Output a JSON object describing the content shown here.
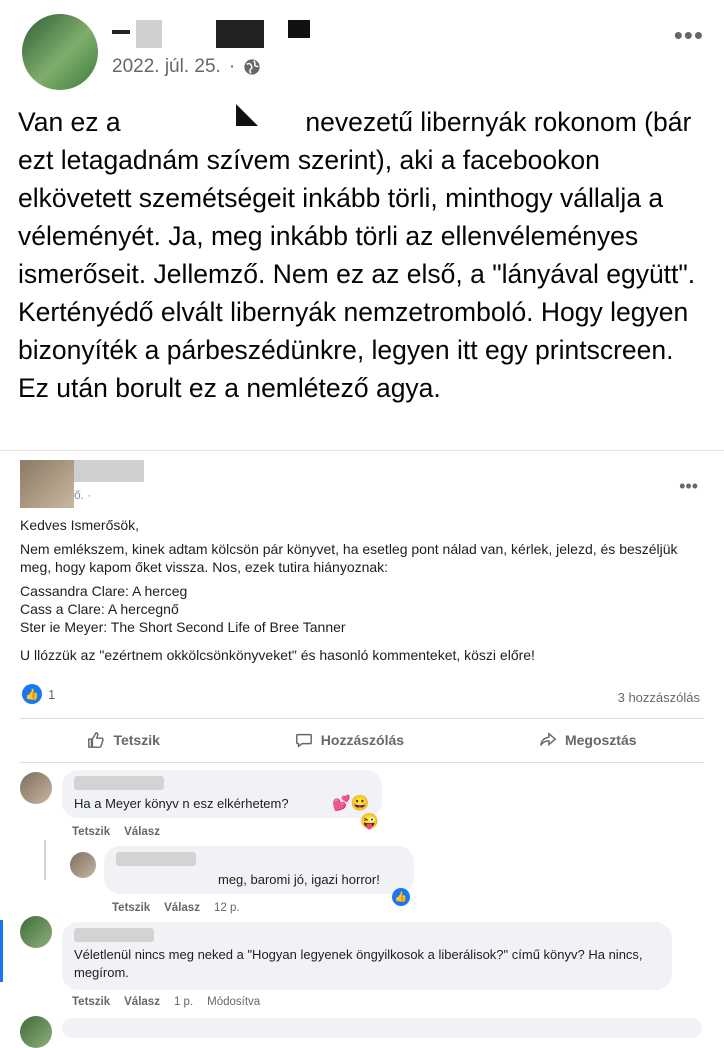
{
  "post": {
    "date": "2022. júl. 25.",
    "separator": "·",
    "more": "•••",
    "text_start": "Van ez a",
    "text_rest": "nevezetű libernyák rokonom (bár ezt letagadnám szívem szerint), aki a facebookon elkövetett szemétségeit inkább törli, minthogy vállalja a véleményét. Ja, meg inkább törli az ellenvéleményes ismerőseit. Jellemző. Nem ez az első, a \"lányával együtt\". Kertényédő elvált libernyák nemzetromboló. Hogy legyen bizonyíték a párbeszédünkre, legyen itt egy printscreen. Ez után borult ez a nemlétező agya."
  },
  "shot": {
    "date": "ő. ·",
    "more": "•••",
    "greeting": "Kedves Ismerősök,",
    "para1": "Nem emlékszem, kinek adtam kölcsön pár könyvet, ha esetleg pont nálad van, kérlek, jelezd, és beszéljük meg, hogy kapom őket vissza. Nos, ezek tutira hiányoznak:",
    "book1": "Cassandra Clare: A herceg",
    "book2": "Cass    a Clare: A hercegnő",
    "book3": "Ster     ie Meyer: The Short Second Life of Bree Tanner",
    "para2": "U        llózzük az \"ezértnem     okkölcsönkönyveket\" és hasonló kommenteket, köszi előre!",
    "reaction_count": "1",
    "comments_count": "3 hozzászólás",
    "actions": {
      "like": "Tetszik",
      "comment": "Hozzászólás",
      "share": "Megosztás"
    }
  },
  "comments": [
    {
      "text": "Ha a Meyer könyv n      esz elkérhetem?",
      "emojis": "💕😀",
      "emoji2": "😜",
      "like": "Tetszik",
      "reply": "Válasz"
    },
    {
      "text": "meg, baromi jó, igazi horror!",
      "like": "Tetszik",
      "reply": "Válasz",
      "time": "12 p.",
      "reaction": "👍"
    },
    {
      "text": "Véletlenül nincs meg neked a \"Hogyan legyenek öngyilkosok a liberálisok?\" című könyv? Ha nincs, megírom.",
      "like": "Tetszik",
      "reply": "Válasz",
      "time": "1 p.",
      "edited": "Módosítva"
    }
  ],
  "colors": {
    "accent": "#1877f2",
    "muted": "#65676b",
    "bubble": "#f0f2f5"
  }
}
